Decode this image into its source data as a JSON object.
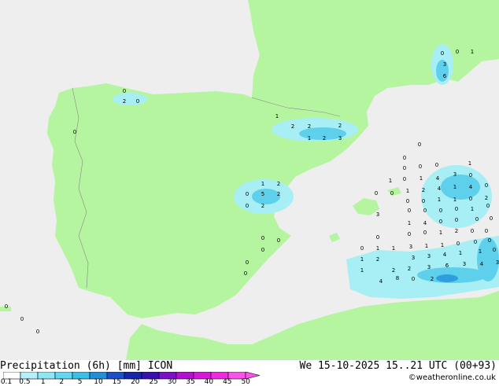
{
  "title": "Precipitation (6h) [mm] ICON",
  "valid_time": "We 15-10-2025 15..21 UTC (00+93)",
  "credit": "©weatheronline.co.uk",
  "colors": {
    "land": "#b5f5a0",
    "sea": "#eeeeee",
    "border": "#888888",
    "precip_light": "#a7eef5",
    "precip_mid": "#5fd0ec",
    "precip_heavy": "#2d9fe0"
  },
  "legend": {
    "ticks": [
      "0.1",
      "0.5",
      "1",
      "2",
      "5",
      "10",
      "15",
      "20",
      "25",
      "30",
      "35",
      "40",
      "45",
      "50"
    ],
    "colors": [
      "#ffffff",
      "#b4f0fa",
      "#8ee6f5",
      "#61d7f0",
      "#3bbfe8",
      "#1f8fd8",
      "#1a4fc8",
      "#1525a8",
      "#3a0fb0",
      "#7a10c8",
      "#b012d0",
      "#d818d8",
      "#f02ae0",
      "#f855e8"
    ]
  },
  "values": {
    "galicia": [
      "0",
      "2",
      "0",
      "0"
    ],
    "catalonia": [
      "1",
      "2",
      "2",
      "2",
      "1",
      "2",
      "3"
    ],
    "provence": [
      "0",
      "0",
      "1",
      "3",
      "6"
    ],
    "valencia": [
      "1",
      "2",
      "0",
      "5",
      "2",
      "0",
      "2",
      "0",
      "0",
      "0",
      "0",
      "0"
    ],
    "balearic_sea": [
      "0",
      "0",
      "0",
      "0",
      "0",
      "1",
      "1",
      "0",
      "1",
      "4",
      "3",
      "0",
      "0",
      "0",
      "1",
      "2",
      "4",
      "1",
      "4",
      "0",
      "0",
      "0",
      "1",
      "1",
      "0",
      "2",
      "3",
      "0",
      "0",
      "0",
      "0",
      "1",
      "0",
      "1",
      "4",
      "0",
      "0",
      "0",
      "0",
      "0",
      "0",
      "1",
      "2",
      "0",
      "0",
      "0",
      "0",
      "1",
      "1",
      "3",
      "1",
      "1",
      "0",
      "0",
      "0",
      "1",
      "2",
      "3",
      "3",
      "4",
      "1",
      "1",
      "0",
      "1",
      "2",
      "2",
      "3",
      "6",
      "3",
      "4",
      "3",
      "4",
      "8",
      "0",
      "2"
    ],
    "atlantic": [
      "0",
      "0",
      "0"
    ]
  }
}
